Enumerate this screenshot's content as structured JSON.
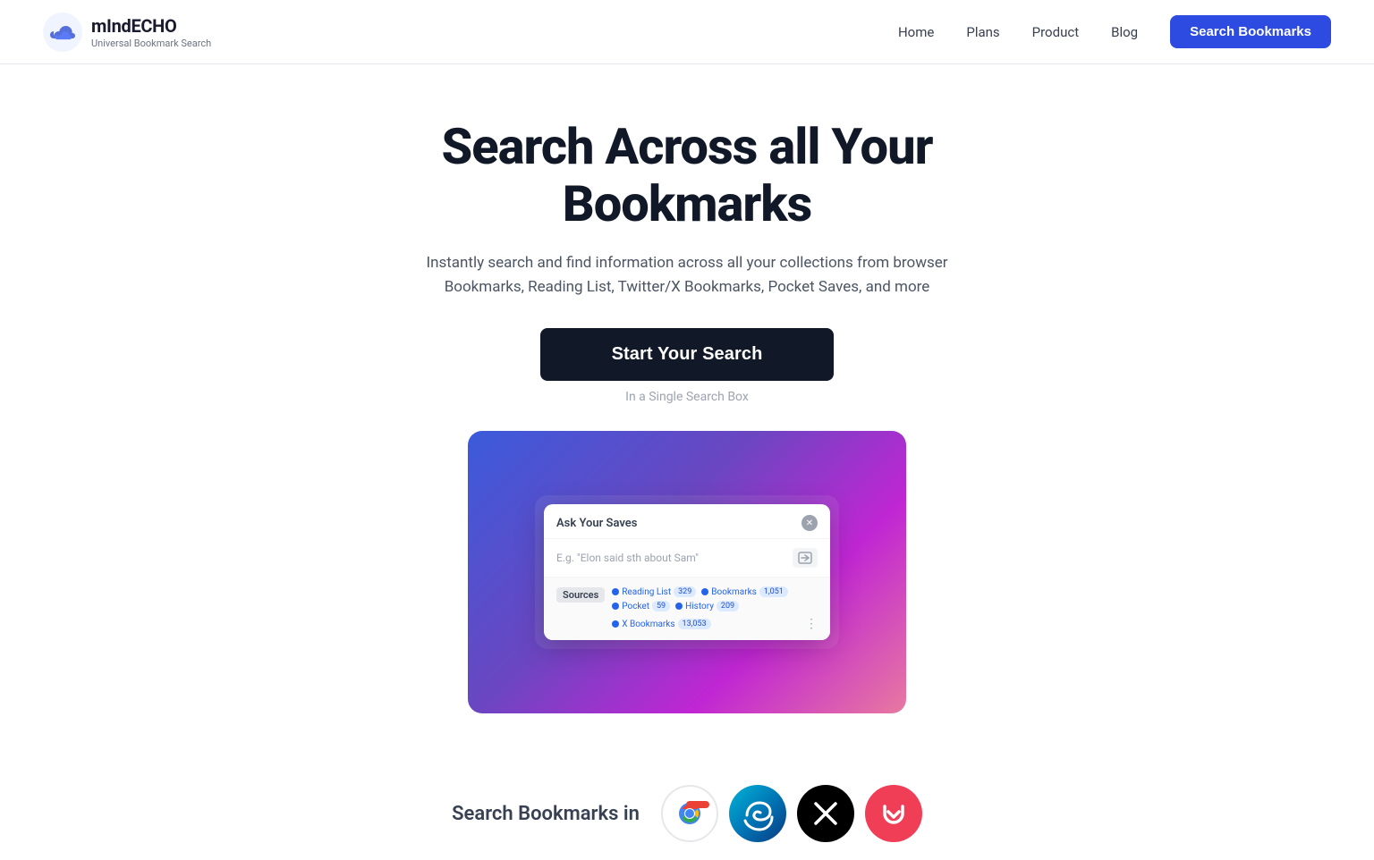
{
  "header": {
    "logo_name": "mIndECHO",
    "logo_subtitle": "Universal Bookmark Search",
    "nav": {
      "home": "Home",
      "plans": "Plans",
      "product": "Product",
      "blog": "Blog"
    },
    "cta_button": "Search Bookmarks"
  },
  "hero": {
    "title": "Search Across all Your Bookmarks",
    "subtitle": "Instantly search and find information across all your collections from browser\nBookmarks, Reading List, Twitter/X Bookmarks, Pocket Saves, and more",
    "search_button": "Start Your Search",
    "search_hint": "In a Single Search Box"
  },
  "demo": {
    "dialog_title": "Ask Your Saves",
    "dialog_placeholder": "E.g. \"Elon said sth about Sam\"",
    "sources_label": "Sources",
    "source1_name": "Reading List",
    "source1_count": "329",
    "source2_name": "Bookmarks",
    "source2_count": "1,051",
    "source3_name": "Pocket",
    "source3_count": "59",
    "source4_name": "History",
    "source4_count": "209",
    "source5_name": "X Bookmarks",
    "source5_count": "13,053"
  },
  "bottom": {
    "text": "Search Bookmarks in"
  },
  "colors": {
    "cta_bg": "#2d4be0",
    "search_btn_bg": "#111827",
    "gradient_start": "#3b5bdb",
    "gradient_mid": "#6b46c1",
    "gradient_end": "#e879a0"
  }
}
